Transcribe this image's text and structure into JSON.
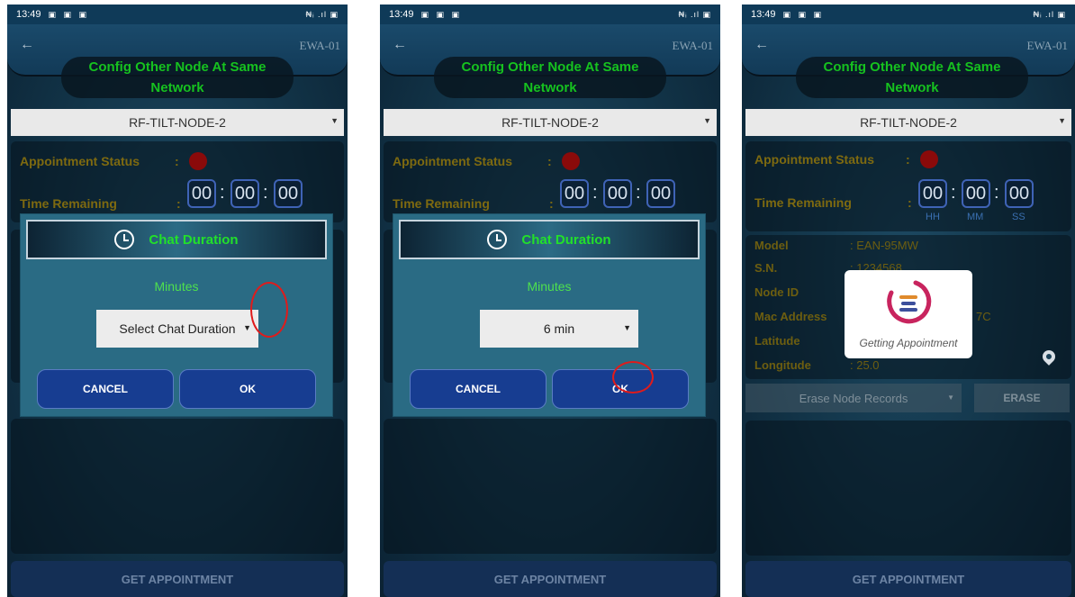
{
  "colors": {
    "accent_green": "#16c21f",
    "label_gold": "#7e6a10",
    "button_blue": "#173d91",
    "annotation_red": "#e01b1b"
  },
  "statusbar": {
    "time": "13:49",
    "right": "₦ᵢ .ıl ▣"
  },
  "header": {
    "back_icon": "arrow-left-icon",
    "device": "EWA-01",
    "title_line1": "Config Other Node At Same",
    "title_line2": "Network"
  },
  "node_select": {
    "value": "RF-TILT-NODE-2"
  },
  "appointment": {
    "status_label": "Appointment Status",
    "time_label": "Time Remaining",
    "colon": ":",
    "hh": "00",
    "mm": "00",
    "ss": "00",
    "unit_hh": "HH",
    "unit_mm": "MM",
    "unit_ss": "SS"
  },
  "dialog": {
    "title": "Chat Duration",
    "minutes_label": "Minutes",
    "select_placeholder": "Select Chat Duration",
    "select_value": "6 min",
    "cancel": "CANCEL",
    "ok": "OK"
  },
  "node_info": {
    "model_label": "Model",
    "model_value": ": EAN-95MW",
    "sn_label": "S.N.",
    "sn_value": ": 1234568",
    "node_id_label": "Node ID",
    "mac_label": "Mac Address",
    "mac_value": "7C",
    "lat_label": "Latitude",
    "lon_label": "Longitude",
    "lon_value": ": 25.0"
  },
  "erase": {
    "select_value": "Erase Node Records",
    "button": "ERASE"
  },
  "loader": {
    "text": "Getting Appointment"
  },
  "get_appointment": "GET APPOINTMENT"
}
